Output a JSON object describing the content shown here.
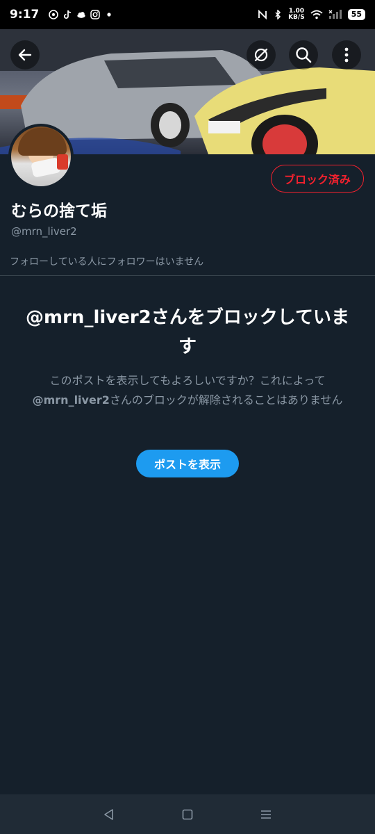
{
  "status_bar": {
    "time": "9:17",
    "net_speed_value": "1.00",
    "net_speed_unit": "KB/S",
    "battery": "55",
    "left_icons": [
      "app-icon",
      "tiktok-icon",
      "weather-icon",
      "instagram-icon",
      "dot-icon"
    ],
    "right_icons": [
      "nfc-icon",
      "bluetooth-icon",
      "wifi-icon",
      "signal-icon"
    ]
  },
  "header": {
    "back_icon": "arrow-left-icon",
    "actions": [
      "unfollow-slash-icon",
      "search-icon",
      "more-vertical-icon"
    ]
  },
  "profile": {
    "blocked_label": "ブロック済み",
    "display_name": "むらの捨て垢",
    "handle": "@mrn_liver2",
    "followers_note": "フォローしている人にフォロワーはいません"
  },
  "blocked_notice": {
    "title": "@mrn_liver2さんをブロックしています",
    "desc_prefix": "このポストを表示してもよろしいですか？これによって",
    "desc_handle": "@mrn_liver2",
    "desc_suffix": "さんのブロックが解除されることはありません",
    "view_button": "ポストを表示"
  },
  "system_nav": {
    "icons": [
      "back-triangle-icon",
      "home-square-icon",
      "menu-lines-icon"
    ]
  },
  "colors": {
    "background": "#15202b",
    "accent": "#1d9bf0",
    "danger": "#f4212e",
    "muted_text": "#8b98a5"
  }
}
